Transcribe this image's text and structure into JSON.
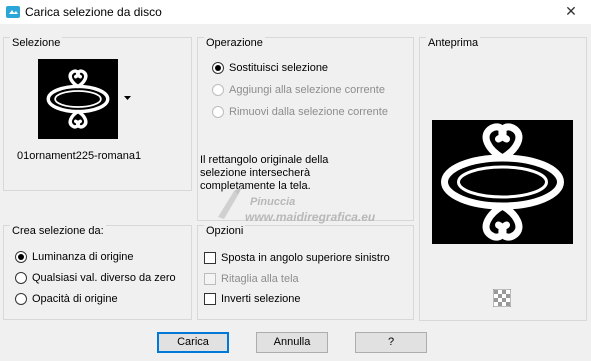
{
  "window": {
    "title": "Carica selezione da disco",
    "close_label": "✕"
  },
  "selection_group": {
    "label": "Selezione",
    "file_name": "01ornament225-romana1"
  },
  "operation_group": {
    "label": "Operazione",
    "options": [
      {
        "label": "Sostituisci selezione",
        "checked": true,
        "disabled": false
      },
      {
        "label": "Aggiungi alla selezione corrente",
        "checked": false,
        "disabled": true
      },
      {
        "label": "Rimuovi dalla selezione corrente",
        "checked": false,
        "disabled": true
      }
    ],
    "description_line1": "Il rettangolo originale della",
    "description_line2": "selezione intersecherà",
    "description_line3": "completamente la tela."
  },
  "preview_group": {
    "label": "Anteprima"
  },
  "create_group": {
    "label": "Crea selezione da:",
    "options": [
      {
        "label": "Luminanza di origine",
        "checked": true
      },
      {
        "label": "Qualsiasi val. diverso da zero",
        "checked": false
      },
      {
        "label": "Opacità di origine",
        "checked": false
      }
    ]
  },
  "options_group": {
    "label": "Opzioni",
    "options": [
      {
        "label": "Sposta in angolo superiore sinistro",
        "checked": false,
        "disabled": false
      },
      {
        "label": "Ritaglia alla tela",
        "checked": false,
        "disabled": true
      },
      {
        "label": "Inverti selezione",
        "checked": false,
        "disabled": false
      }
    ]
  },
  "watermark": {
    "line1": "Pinuccia",
    "line2": "www.maidiregrafica.eu"
  },
  "buttons": {
    "ok": "Carica",
    "cancel": "Annulla",
    "help": "?"
  },
  "colors": {
    "accent": "#0078d7",
    "preview_bg": "#000000"
  }
}
